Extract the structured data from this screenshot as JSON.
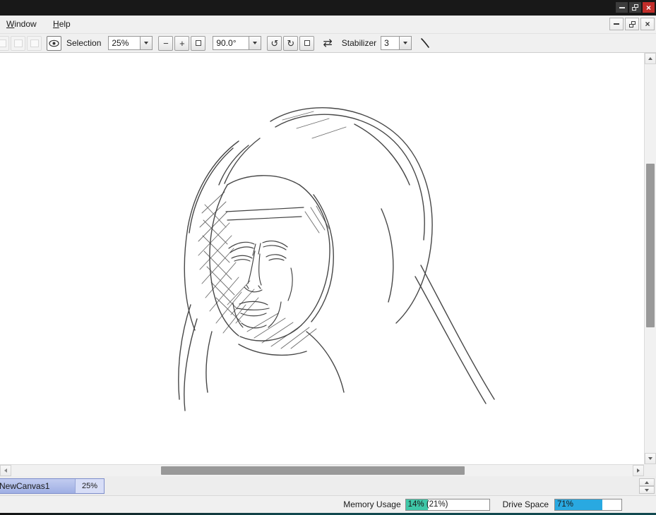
{
  "titlebar": {
    "close_glyph": "×"
  },
  "menubar": {
    "items": [
      {
        "label": "Window"
      },
      {
        "label": "Help"
      }
    ]
  },
  "toolbar": {
    "selection_label": "Selection",
    "zoom": {
      "value": "25%"
    },
    "zoom_out": "−",
    "zoom_in": "+",
    "rotation": {
      "value": "90.0°"
    },
    "rotate_ccw": "↺",
    "rotate_cw": "↻",
    "flip_icon": "⇄",
    "stabilizer_label": "Stabilizer",
    "stabilizer": {
      "value": "3"
    }
  },
  "tabbar": {
    "title": "NewCanvas1",
    "zoom": "25%"
  },
  "statusbar": {
    "memory_label": "Memory Usage",
    "memory_value": "14% (21%)",
    "memory_fill_percent": 27,
    "drive_label": "Drive Space",
    "drive_value": "71%",
    "drive_fill_percent": 71
  },
  "colors": {
    "memory_fill": "#3fc8a8",
    "drive_fill": "#29a9e1",
    "close_button": "#c12e2a",
    "tab_highlight": "#a9b6e8"
  }
}
